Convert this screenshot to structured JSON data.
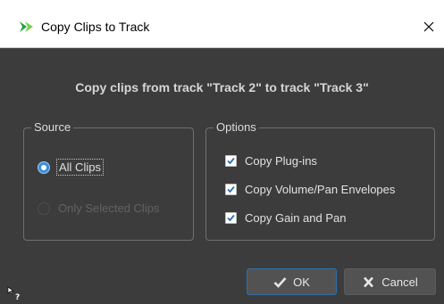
{
  "window": {
    "title": "Copy Clips to Track",
    "app_icon": "steinberg-arrow-icon",
    "close_icon": "close-icon"
  },
  "heading": "Copy clips from track \"Track 2\" to track \"Track 3\"",
  "source": {
    "legend": "Source",
    "options": [
      {
        "label": "All Clips",
        "selected": true,
        "enabled": true
      },
      {
        "label": "Only Selected Clips",
        "selected": false,
        "enabled": false
      }
    ]
  },
  "options": {
    "legend": "Options",
    "checkboxes": [
      {
        "label": "Copy Plug-ins",
        "checked": true
      },
      {
        "label": "Copy Volume/Pan Envelopes",
        "checked": true
      },
      {
        "label": "Copy Gain and Pan",
        "checked": true
      }
    ]
  },
  "buttons": {
    "ok_label": "OK",
    "ok_icon": "checkmark-icon",
    "cancel_label": "Cancel",
    "cancel_icon": "x-icon"
  },
  "help_cursor_icon": "help-cursor-icon",
  "colors": {
    "background": "#3c3c3c",
    "accent": "#3b8fd9",
    "app_icon_green": "#1ea34f",
    "text": "#e0e0e0",
    "disabled_text": "#626262"
  }
}
